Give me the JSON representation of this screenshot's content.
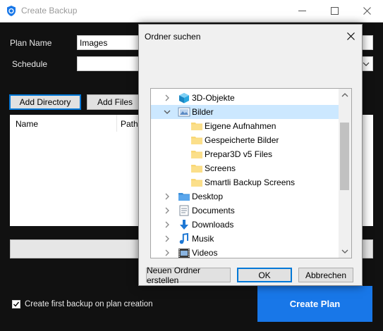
{
  "window": {
    "title": "Create Backup",
    "controls": [
      "minimize",
      "maximize",
      "close"
    ]
  },
  "form": {
    "plan_name_label": "Plan Name",
    "plan_name_value": "Images",
    "schedule_label": "Schedule",
    "schedule_value": "",
    "add_directory_label": "Add Directory",
    "add_files_label": "Add Files",
    "columns": [
      "Name",
      "Path"
    ],
    "first_backup_label": "Create first backup on plan creation",
    "first_backup_checked": true,
    "create_plan_label": "Create Plan"
  },
  "dialog": {
    "title": "Ordner suchen",
    "tree": [
      {
        "label": "3D-Objekte",
        "level": 0,
        "expanded": false,
        "icon": "3d-objects-icon"
      },
      {
        "label": "Bilder",
        "level": 0,
        "expanded": true,
        "selected": true,
        "icon": "pictures-folder-icon"
      },
      {
        "label": "Eigene Aufnahmen",
        "level": 1,
        "icon": "folder-icon"
      },
      {
        "label": "Gespeicherte Bilder",
        "level": 1,
        "icon": "folder-icon"
      },
      {
        "label": "Prepar3D v5 Files",
        "level": 1,
        "icon": "folder-icon"
      },
      {
        "label": "Screens",
        "level": 1,
        "icon": "folder-icon"
      },
      {
        "label": "Smartli Backup Screens",
        "level": 1,
        "icon": "folder-icon"
      },
      {
        "label": "Desktop",
        "level": 0,
        "expanded": false,
        "icon": "desktop-folder-icon"
      },
      {
        "label": "Documents",
        "level": 0,
        "expanded": false,
        "icon": "documents-icon"
      },
      {
        "label": "Downloads",
        "level": 0,
        "expanded": false,
        "icon": "downloads-icon"
      },
      {
        "label": "Musik",
        "level": 0,
        "expanded": false,
        "icon": "music-icon"
      },
      {
        "label": "Videos",
        "level": 0,
        "expanded": false,
        "icon": "videos-icon"
      }
    ],
    "new_folder_label": "Neuen Ordner erstellen",
    "ok_label": "OK",
    "cancel_label": "Abbrechen"
  },
  "colors": {
    "accent": "#1877e8",
    "selection": "#cce8ff",
    "background": "#111111"
  }
}
